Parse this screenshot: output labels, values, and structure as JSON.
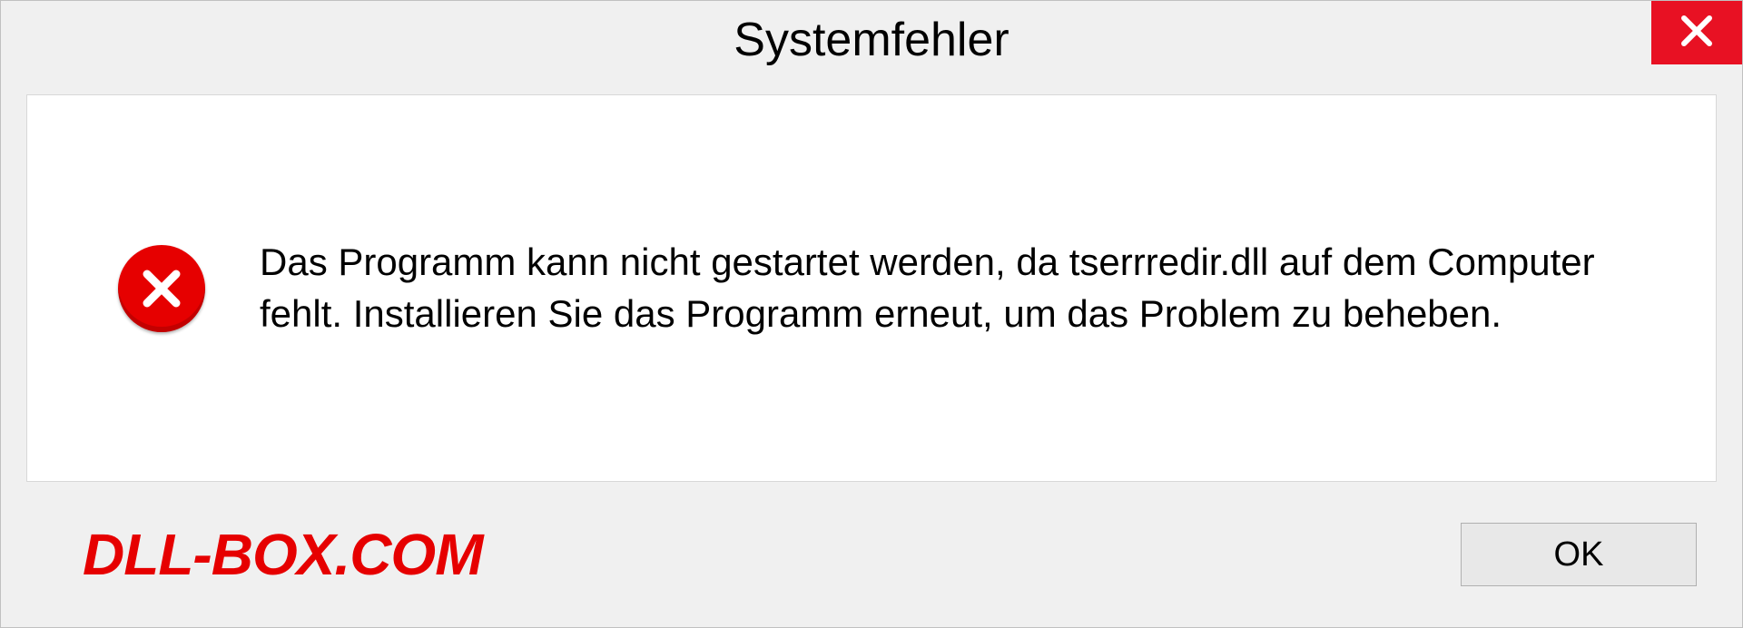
{
  "dialog": {
    "title": "Systemfehler",
    "message": "Das Programm kann nicht gestartet werden, da tserrredir.dll auf dem Computer fehlt. Installieren Sie das Programm erneut, um das Problem zu beheben.",
    "ok_label": "OK"
  },
  "watermark": "DLL-BOX.COM",
  "colors": {
    "close_button": "#e81123",
    "error_icon": "#e60000",
    "watermark": "#e60000"
  }
}
